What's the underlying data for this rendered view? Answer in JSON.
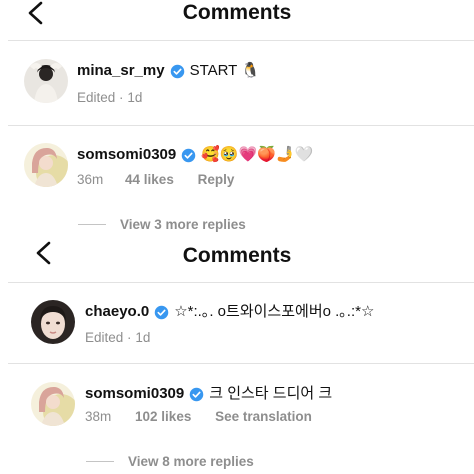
{
  "panel_top": {
    "header": {
      "title": "Comments",
      "back_icon": "chevron-left-icon"
    },
    "comments": [
      {
        "username": "mina_sr_my",
        "text": "START 🐧",
        "meta": {
          "time": "Edited",
          "dot": "·",
          "age": "1d"
        }
      },
      {
        "username": "somsomi0309",
        "text": "🥰🥹💗🍑🤳🤍",
        "meta": {
          "time": "36m",
          "likes": "44 likes",
          "reply": "Reply"
        }
      }
    ],
    "view_replies": "View 3 more replies"
  },
  "panel_bottom": {
    "header": {
      "title": "Comments",
      "back_icon": "chevron-left-icon"
    },
    "comments": [
      {
        "username": "chaeyo.0",
        "text": "☆*:.｡. o트와이스포에버o .｡.:*☆",
        "meta": {
          "time": "Edited",
          "dot": "·",
          "age": "1d"
        }
      },
      {
        "username": "somsomi0309",
        "text": "크 인스타 드디어 크",
        "meta": {
          "time": "38m",
          "likes": "102 likes",
          "translate": "See translation"
        }
      }
    ],
    "view_replies": "View 8 more replies"
  },
  "colors": {
    "verified_badge": "#3897f0",
    "secondary_text": "#8e8e8e",
    "divider": "#e2e2e2"
  },
  "icons": {
    "verified": "verified-badge-icon",
    "back": "chevron-left-icon"
  }
}
